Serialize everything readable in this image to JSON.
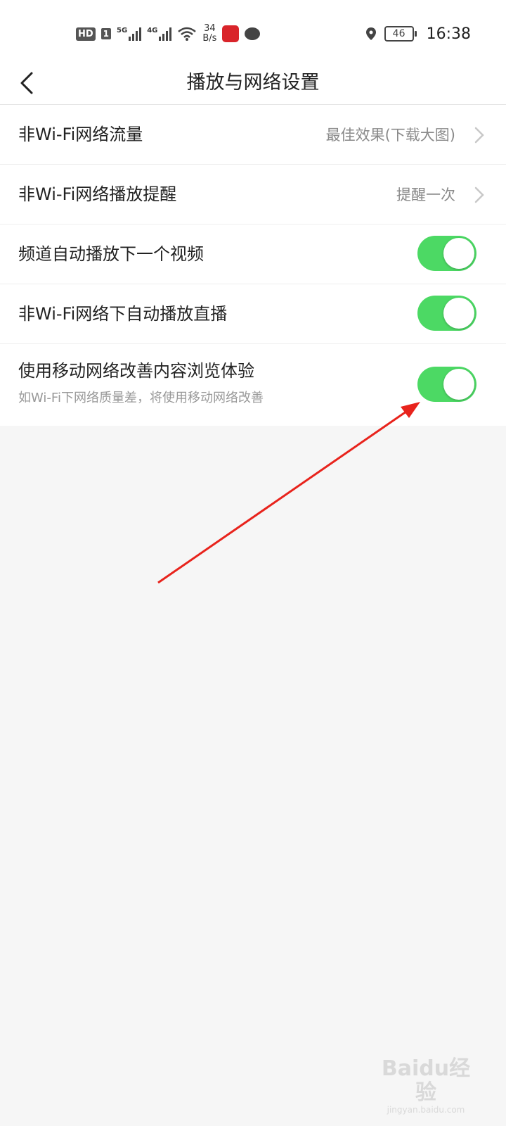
{
  "status_bar": {
    "hd_badge": "HD",
    "sim_badge": "1",
    "network1": "5G",
    "network2": "4G",
    "speed_value": "34",
    "speed_unit": "B/s",
    "battery": "46",
    "time": "16:38"
  },
  "header": {
    "title": "播放与网络设置"
  },
  "settings": [
    {
      "label": "非Wi-Fi网络流量",
      "value": "最佳效果(下载大图)"
    },
    {
      "label": "非Wi-Fi网络播放提醒",
      "value": "提醒一次"
    },
    {
      "label": "频道自动播放下一个视频",
      "toggle": true
    },
    {
      "label": "非Wi-Fi网络下自动播放直播",
      "toggle": true
    },
    {
      "label": "使用移动网络改善内容浏览体验",
      "sublabel": "如Wi-Fi下网络质量差，将使用移动网络改善",
      "toggle": true
    }
  ],
  "annotation": {
    "color": "#e8231c"
  },
  "toggle_color": "#4cd964",
  "watermark": {
    "logo": "Baidu经验",
    "url": "jingyan.baidu.com"
  }
}
